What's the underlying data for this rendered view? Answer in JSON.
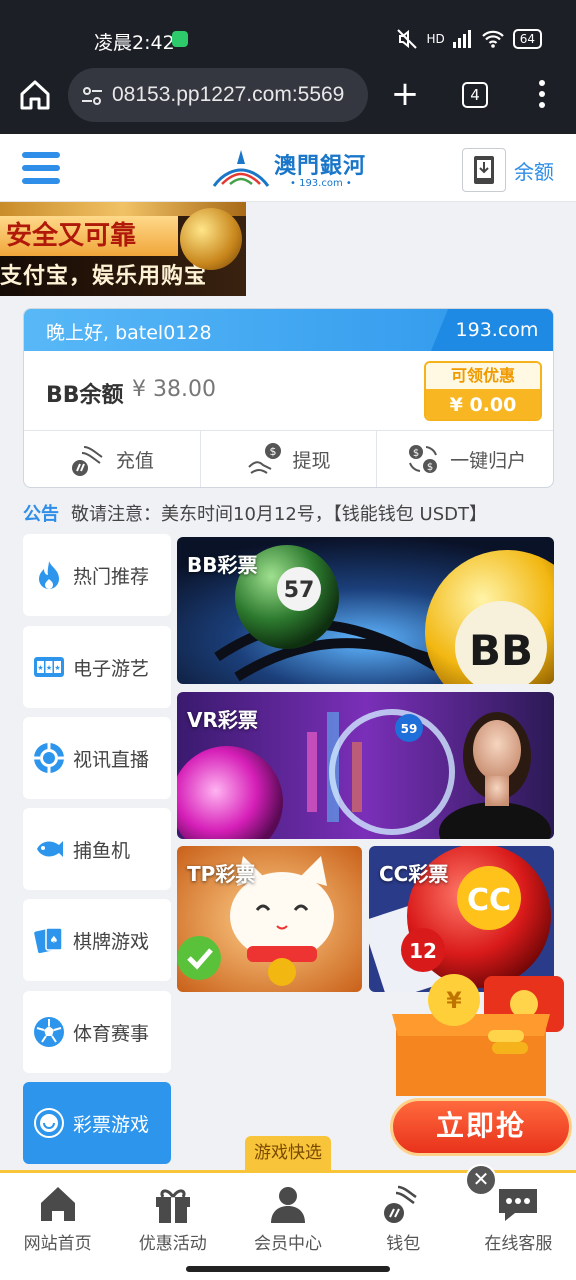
{
  "status_bar": {
    "time": "凌晨2:42",
    "network": "HD",
    "battery": "64"
  },
  "browser": {
    "url": "08153.pp1227.com:5569",
    "tab_count": "4"
  },
  "site_header": {
    "logo_name": "澳門銀河",
    "logo_sub": "• 193.com •",
    "balance_link": "余额"
  },
  "banner": {
    "line1": "安全又可靠",
    "line2": "支付宝，娱乐用购宝"
  },
  "account": {
    "greeting": "晚上好, batel0128",
    "domain": "193.com",
    "balance_label": "BB余额",
    "balance_value": "¥ 38.00",
    "promo_label": "可领优惠",
    "promo_value": "¥ 0.00",
    "actions": [
      "充值",
      "提现",
      "一键归户"
    ]
  },
  "notice": {
    "label": "公告",
    "text": "敬请注意：美东时间10月12号，【钱能钱包 USDT】"
  },
  "categories": [
    "热门推荐",
    "电子游艺",
    "视讯直播",
    "捕鱼机",
    "棋牌游戏",
    "体育赛事",
    "彩票游戏"
  ],
  "games": [
    "BB彩票",
    "VR彩票",
    "TP彩票",
    "CC彩票"
  ],
  "promo_packet": {
    "button": "立即抢"
  },
  "quick_tab": "游戏快选",
  "bottom_nav": [
    "网站首页",
    "优惠活动",
    "会员中心",
    "钱包",
    "在线客服"
  ],
  "colors": {
    "primary": "#2d96ec",
    "accent": "#f7c43a",
    "dark": "#1c1f26"
  }
}
